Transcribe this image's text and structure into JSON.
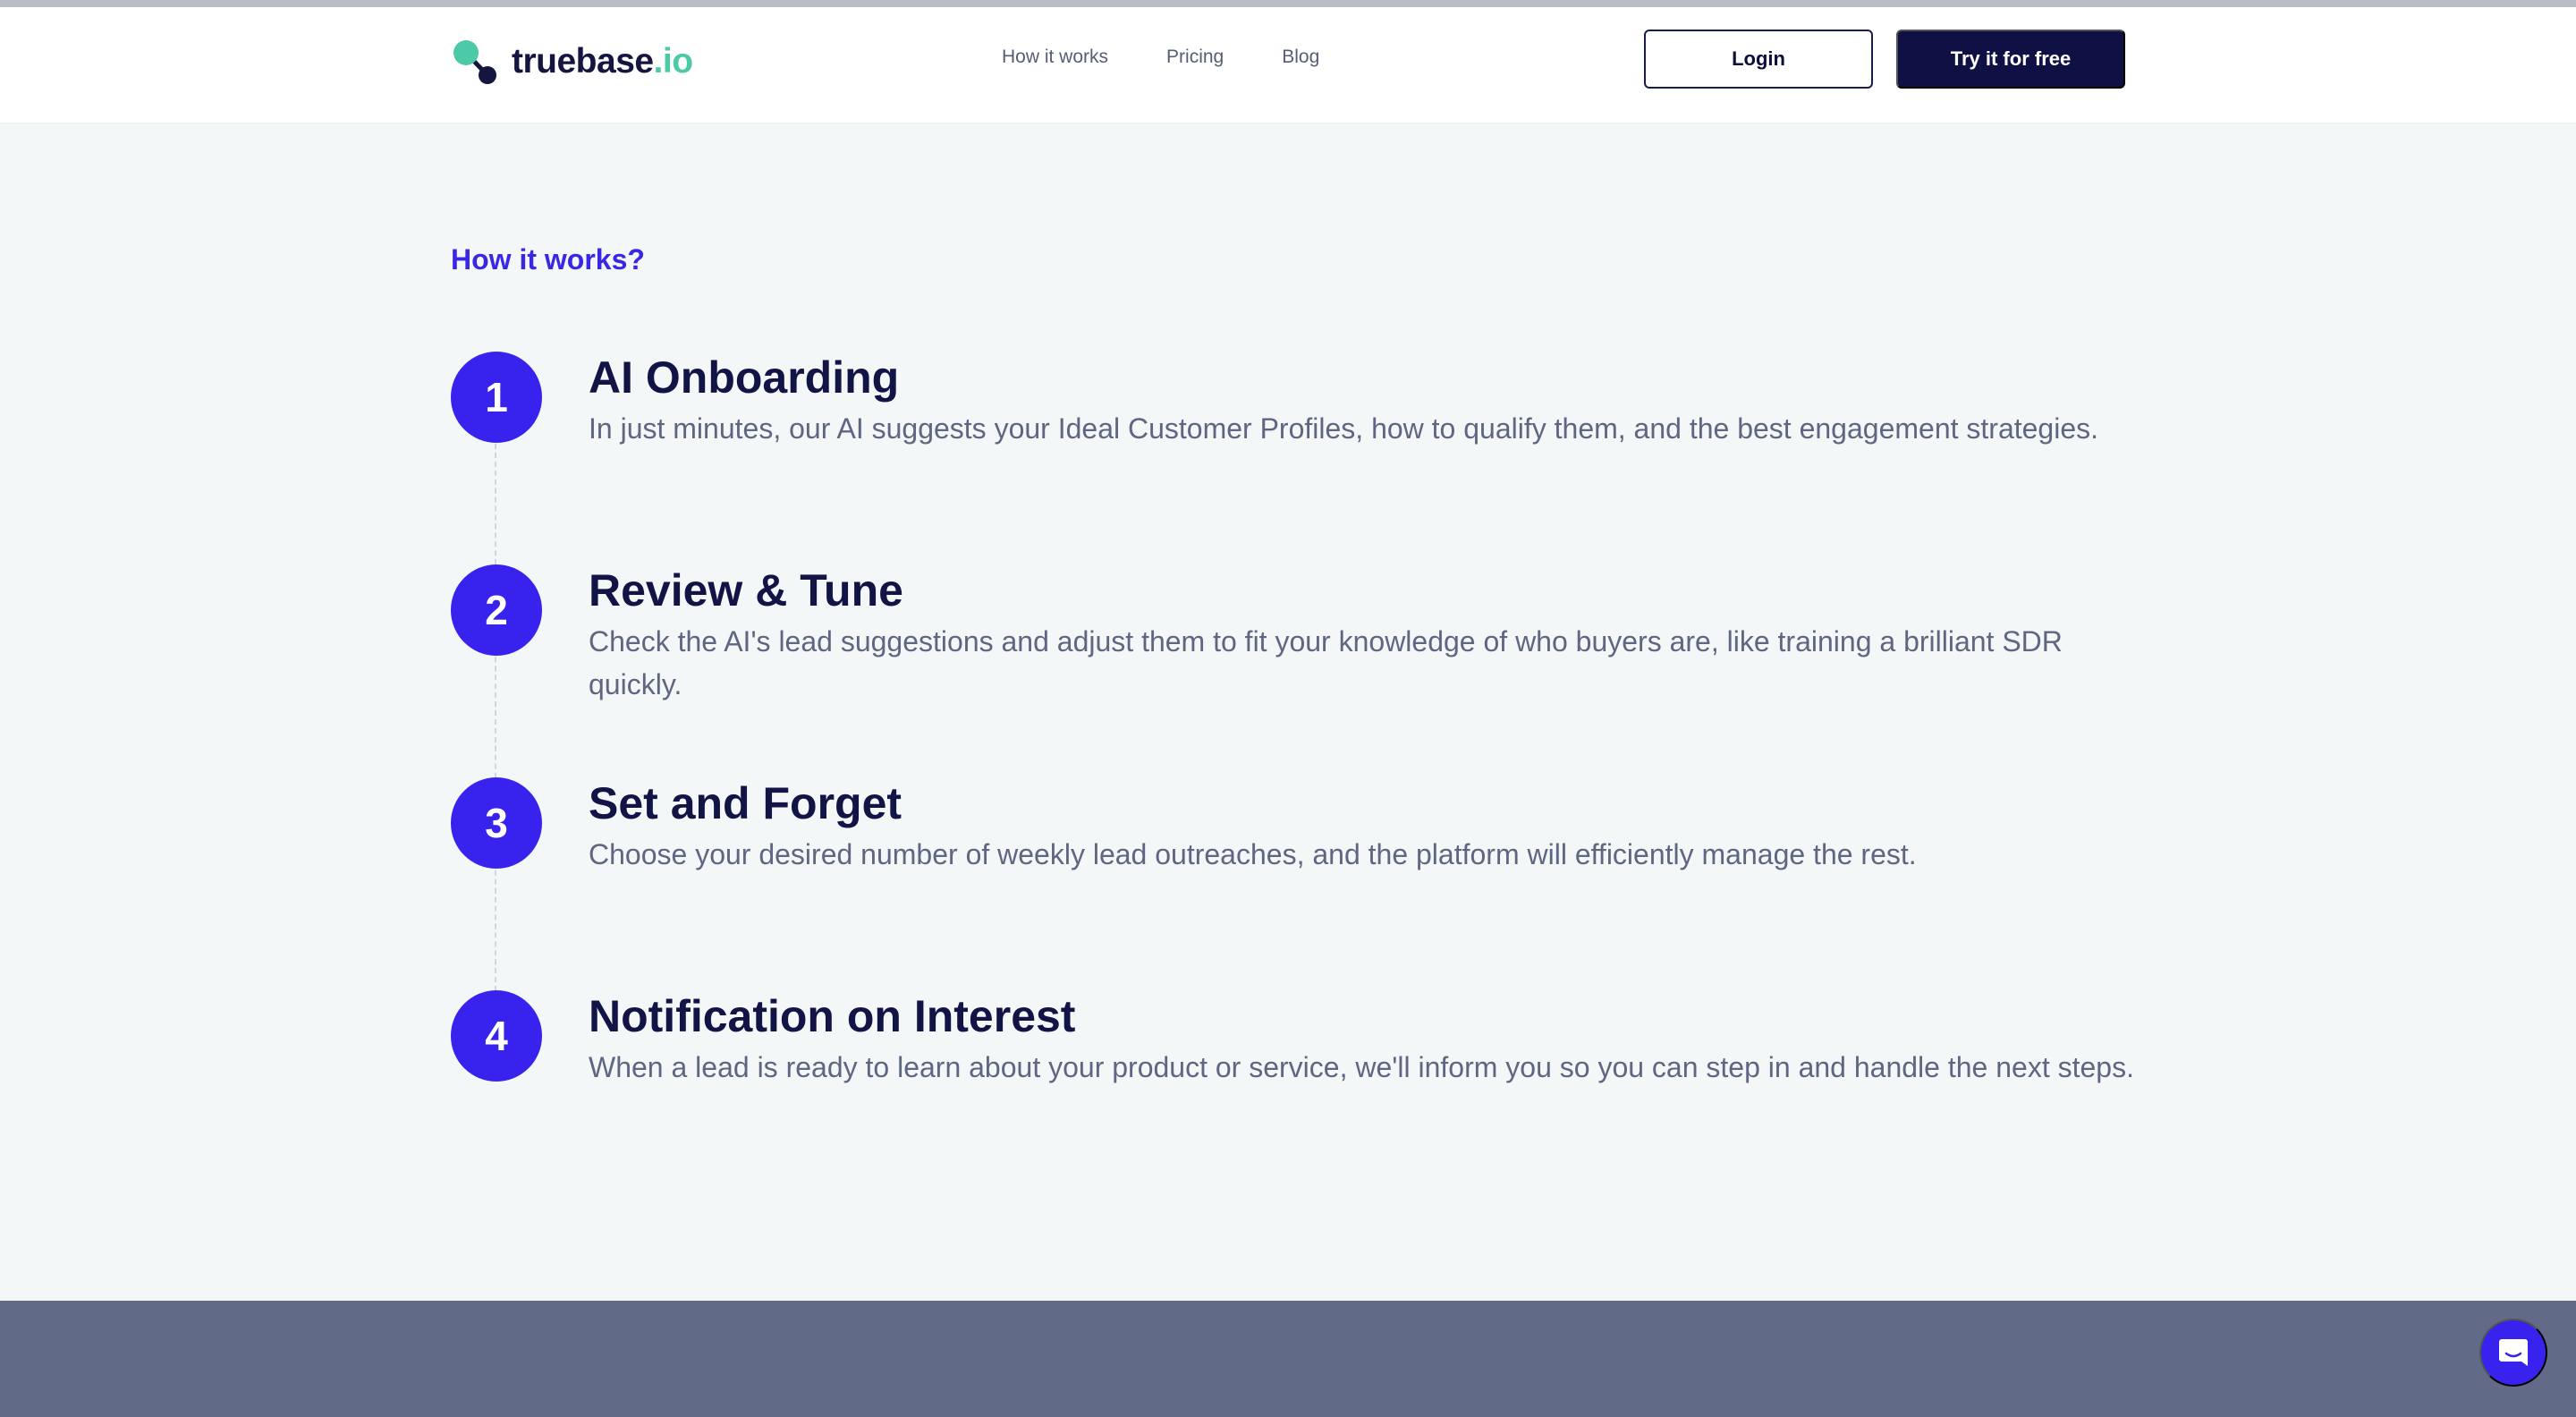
{
  "brand": {
    "name": "truebase",
    "tld": ".io"
  },
  "nav": [
    {
      "label": "How it works"
    },
    {
      "label": "Pricing"
    },
    {
      "label": "Blog"
    }
  ],
  "header": {
    "login_label": "Login",
    "cta_label": "Try it for free"
  },
  "section": {
    "kicker": "How it works?",
    "steps": [
      {
        "number": "1",
        "title": "AI Onboarding",
        "desc": "In just minutes, our AI suggests your Ideal Customer Profiles, how to qualify them, and the best engagement strategies."
      },
      {
        "number": "2",
        "title": "Review & Tune",
        "desc": "Check the AI's lead suggestions and adjust them to fit your knowledge of who buyers are, like training a brilliant SDR quickly."
      },
      {
        "number": "3",
        "title": "Set and Forget",
        "desc": "Choose your desired number of weekly lead outreaches, and the platform will efficiently manage the rest."
      },
      {
        "number": "4",
        "title": "Notification on Interest",
        "desc": "When a lead is ready to learn about your product or service, we'll inform you so you can step in and handle the next steps."
      }
    ]
  },
  "icons": {
    "logo": "truebase-logo-icon",
    "chat": "chat-bubble-icon"
  },
  "colors": {
    "accent": "#3823ee",
    "navy": "#0f1144",
    "logo_green": "#4cc9a6",
    "footer": "#616b88"
  }
}
